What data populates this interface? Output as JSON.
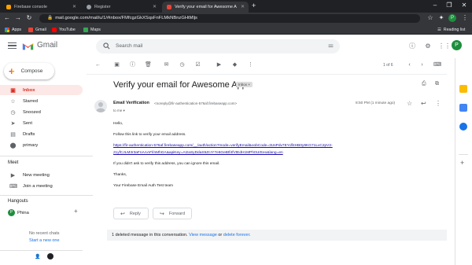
{
  "browser": {
    "tabs": [
      {
        "title": "Firebase console",
        "color": "#ffa000",
        "active": false
      },
      {
        "title": "Register",
        "color": "#9aa0a6",
        "active": false
      },
      {
        "title": "Verify your email for Awesome A",
        "color": "#ea4335",
        "active": true
      }
    ],
    "url": "mail.google.com/mail/u/1/#inbox/FMfcgzGkXSqsFnFLMkNBnzGHtMljs",
    "bookmarks": [
      "Apps",
      "Gmail",
      "YouTube",
      "Maps"
    ],
    "reading_list": "Reading list"
  },
  "gmail": {
    "logo_text": "Gmail",
    "search_placeholder": "Search mail",
    "avatar_initial": "P"
  },
  "sidebar": {
    "compose_label": "Compose",
    "items": [
      {
        "label": "Inbox",
        "icon": "inbox-icon",
        "selected": true
      },
      {
        "label": "Starred",
        "icon": "star-icon",
        "selected": false
      },
      {
        "label": "Snoozed",
        "icon": "clock-icon",
        "selected": false
      },
      {
        "label": "Sent",
        "icon": "send-icon",
        "selected": false
      },
      {
        "label": "Drafts",
        "icon": "draft-icon",
        "selected": false
      },
      {
        "label": "primary",
        "icon": "label-icon",
        "selected": false
      }
    ],
    "meet": {
      "title": "Meet",
      "items": [
        "New meeting",
        "Join a meeting"
      ]
    },
    "hangouts": {
      "title": "Hangouts",
      "user": "Phina",
      "user_initial": "P",
      "no_chats": "No recent chats",
      "start_new": "Start a new one"
    }
  },
  "toolbar": {
    "pager": "1 of 6"
  },
  "message": {
    "subject": "Verify your email for Awesome App",
    "badge": "Inbox ×",
    "sender_name": "Email Verification",
    "sender_email": "<noreply@fir-authentication-576af.firebaseapp.com>",
    "to": "to me ▾",
    "time": "8:50 PM (1 minute ago)",
    "greeting": "Hello,",
    "line1": "Follow this link to verify your email address.",
    "link_line1": "https://fir-authentication-576af.firebaseapp.com/__/auth/action?mode=verifyEmail&oobCode=3UsPdv7EYdf4HB0y9KG71LvC2pV2-",
    "link_line2": "z1yfCJLM3r3aFnAAAFl/nMhGA&apiKey=AIzaSyDdaS5ZcrY7e6GeBtf4fVtEdH1MPh0UrEeo&lang=en",
    "line2": "If you didn't ask to verify this address, you can ignore this email.",
    "thanks": "Thanks,",
    "signature": "Your Firebase Email Auth Test team",
    "reply_label": "Reply",
    "forward_label": "Forward",
    "deleted_prefix": "1 deleted message in this conversation. ",
    "deleted_view": "View message",
    "deleted_or": " or ",
    "deleted_forever": "delete forever."
  }
}
